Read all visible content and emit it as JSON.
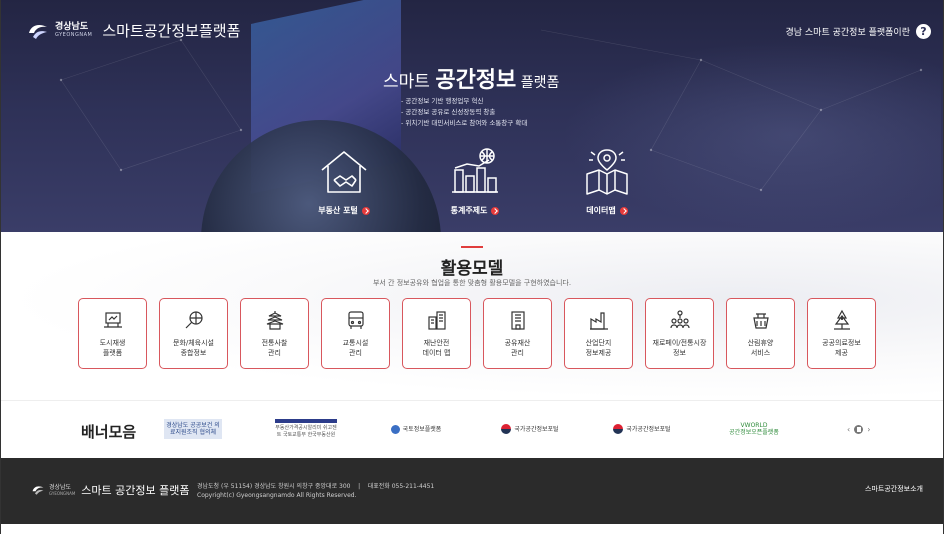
{
  "header": {
    "logo_ko": "경상남도",
    "logo_en": "GYEONGNAM",
    "title": "스마트공간정보플랫폼",
    "intro_link": "경남 스마트 공간정보 플랫폼이란",
    "help_icon": "?"
  },
  "hero": {
    "title_pre": "스마트 ",
    "title_main": "공간정보",
    "title_post": " 플랫폼",
    "bullets": [
      "- 공간정보 기반 행정업무 혁신",
      "- 공간정보 공유로 신성장동력 창출",
      "- 위치기반 대민서비스로 참여와 소통창구 확대"
    ],
    "items": [
      {
        "label": "부동산 포털",
        "icon": "house-handshake-icon"
      },
      {
        "label": "통계주제도",
        "icon": "statistics-city-icon"
      },
      {
        "label": "데이터맵",
        "icon": "map-pin-icon"
      }
    ]
  },
  "models": {
    "title": "활용모델",
    "subtitle": "부서 간 정보공유와 협업을 통한 맞춤형 활용모델을 구현하였습니다.",
    "cards": [
      {
        "label": "도시재생\n플랫폼",
        "icon": "city-renewal-icon"
      },
      {
        "label": "문화/체육시설\n종합정보",
        "icon": "sports-culture-icon"
      },
      {
        "label": "전통사찰\n관리",
        "icon": "temple-icon"
      },
      {
        "label": "교통시설\n관리",
        "icon": "bus-icon"
      },
      {
        "label": "재난안전\n데이터 맵",
        "icon": "disaster-building-icon"
      },
      {
        "label": "공유재산\n관리",
        "icon": "public-building-icon"
      },
      {
        "label": "산업단지\n정보제공",
        "icon": "factory-icon"
      },
      {
        "label": "재로페이/전통시장\n정보",
        "icon": "market-people-icon"
      },
      {
        "label": "산림휴양\n서비스",
        "icon": "forest-basket-icon"
      },
      {
        "label": "공공의료정보\n제공",
        "icon": "medical-trees-icon"
      }
    ]
  },
  "banners": {
    "heading": "배너모음",
    "items": [
      {
        "text": "경상남도 공공보건\n의료지원조직 협의체",
        "name": "banner-public-health"
      },
      {
        "text": "부동산가격공시알리미 쉬고젠트\n국토교통부 한국부동산원",
        "name": "banner-realty-price"
      },
      {
        "text": "국토정보플랫폼",
        "name": "banner-land-info"
      },
      {
        "text": "국가공간정보포털",
        "name": "banner-national-spatial-1"
      },
      {
        "text": "국가공간정보포털",
        "name": "banner-national-spatial-2"
      },
      {
        "text": "VWORLD\n공간정보오픈플랫폼",
        "name": "banner-vworld"
      }
    ],
    "prev": "‹",
    "next": "›"
  },
  "footer": {
    "logo_ko": "경상남도",
    "logo_en": "GYEONGNAM",
    "title": "스마트 공간정보 플랫폼",
    "address": "경남도청 (우 51154) 경상남도 창원시 의창구 중앙대로 300    |    대표전화 055-211-4451",
    "copyright": "Copyright(c) Gyeongsangnamdo All Rights Reserved.",
    "about": "스마트공간정보소개"
  },
  "colors": {
    "hero_bg": "#2e3157",
    "accent_red": "#e03d3d",
    "card_border": "#d8575d",
    "footer_bg": "#2b2b2b"
  }
}
